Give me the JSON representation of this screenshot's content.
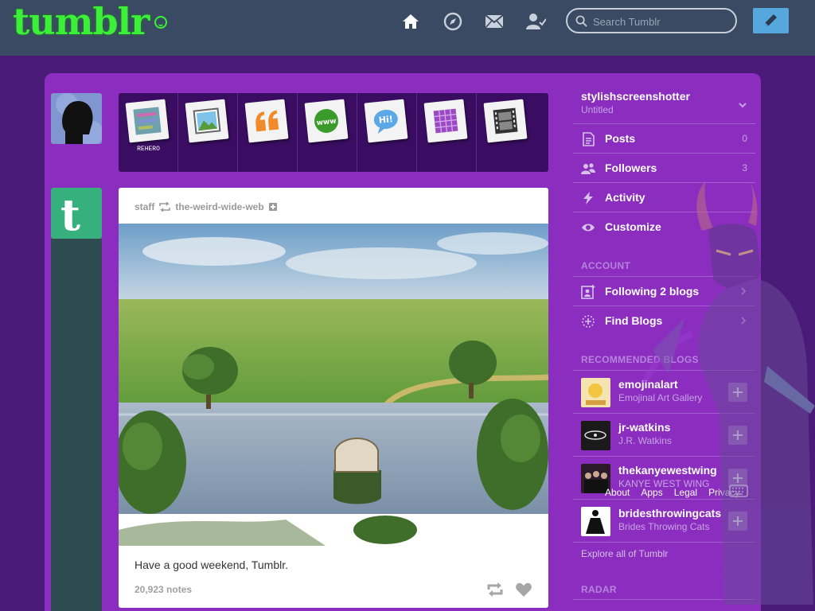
{
  "header": {
    "logo_text": "tumblr",
    "search_placeholder": "Search Tumblr",
    "colors": {
      "bar": "#3a4a62",
      "logo": "#3cf03a",
      "compose": "#56a8dc"
    },
    "nav_icons": [
      "home-icon",
      "explore-icon",
      "inbox-icon",
      "account-icon"
    ]
  },
  "post_types": [
    {
      "name": "text",
      "icon": "text-icon",
      "caption": "REHERO"
    },
    {
      "name": "photo",
      "icon": "photo-icon",
      "caption": ""
    },
    {
      "name": "quote",
      "icon": "quote-icon",
      "caption": ""
    },
    {
      "name": "link",
      "icon": "link-icon",
      "caption": ""
    },
    {
      "name": "chat",
      "icon": "chat-icon",
      "caption": ""
    },
    {
      "name": "audio",
      "icon": "audio-icon",
      "caption": ""
    },
    {
      "name": "video",
      "icon": "video-icon",
      "caption": ""
    }
  ],
  "post": {
    "author": "staff",
    "reblogged_from": "the-weird-wide-web",
    "caption": "Have a good weekend, Tumblr.",
    "notes": "20,923 notes"
  },
  "sidebar": {
    "blog_name": "stylishscreenshotter",
    "blog_title": "Untitled",
    "menu": [
      {
        "label": "Posts",
        "count": "0",
        "icon": "posts-icon"
      },
      {
        "label": "Followers",
        "count": "3",
        "icon": "followers-icon"
      },
      {
        "label": "Activity",
        "count": "",
        "icon": "activity-icon"
      },
      {
        "label": "Customize",
        "count": "",
        "icon": "eye-icon"
      }
    ],
    "account_heading": "ACCOUNT",
    "account": [
      {
        "label": "Following 2 blogs",
        "icon": "following-icon"
      },
      {
        "label": "Find Blogs",
        "icon": "find-blogs-icon"
      }
    ],
    "recommended_heading": "RECOMMENDED BLOGS",
    "recommended": [
      {
        "name": "emojinalart",
        "title": "Emojinal Art Gallery"
      },
      {
        "name": "jr-watkins",
        "title": "J.R. Watkins"
      },
      {
        "name": "thekanyewestwing",
        "title": "KANYE WEST WING"
      },
      {
        "name": "bridesthrowingcats",
        "title": "Brides Throwing Cats"
      }
    ],
    "explore": "Explore all of Tumblr",
    "radar_heading": "RADAR",
    "footer": [
      "About",
      "Apps",
      "Legal",
      "Privacy"
    ]
  }
}
